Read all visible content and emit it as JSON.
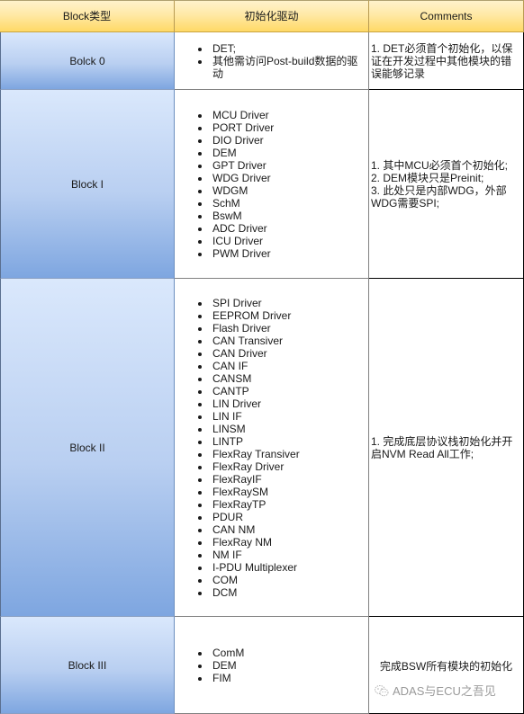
{
  "header": {
    "col1": "Block类型",
    "col2": "初始化驱动",
    "col3": "Comments"
  },
  "rows": [
    {
      "block": "Bolck 0",
      "drivers": [
        "DET;",
        "其他需访问Post-build数据的驱动"
      ],
      "comments": [
        "1. DET必须首个初始化，以保证在开发过程中其他模块的错误能够记录"
      ]
    },
    {
      "block": "Block I",
      "drivers": [
        "MCU  Driver",
        "PORT Driver",
        "DIO Driver",
        "DEM",
        "GPT Driver",
        "WDG Driver",
        "WDGM",
        "SchM",
        "BswM",
        "ADC Driver",
        "ICU Driver",
        "PWM Driver"
      ],
      "comments": [
        "1. 其中MCU必须首个初始化;",
        "2. DEM模块只是Preinit;",
        "3. 此处只是内部WDG，外部WDG需要SPI;"
      ]
    },
    {
      "block": "Block II",
      "drivers": [
        "SPI Driver",
        "EEPROM Driver",
        "Flash Driver",
        "CAN Transiver",
        "CAN Driver",
        "CAN IF",
        "CANSM",
        "CANTP",
        "LIN Driver",
        "LIN  IF",
        "LINSM",
        "LINTP",
        "FlexRay Transiver",
        "FlexRay Driver",
        "FlexRayIF",
        "FlexRaySM",
        "FlexRayTP",
        "PDUR",
        "CAN NM",
        "FlexRay NM",
        "NM IF",
        "I-PDU Multiplexer",
        "COM",
        "DCM"
      ],
      "comments": [
        "1. 完成底层协议栈初始化并开启NVM Read All工作;"
      ]
    },
    {
      "block": "Block III",
      "drivers": [
        "ComM",
        "DEM",
        "FIM"
      ],
      "comments": [
        "完成BSW所有模块的初始化"
      ]
    }
  ],
  "watermark": {
    "icon": "wechat-icon",
    "text": "ADAS与ECU之吾见"
  }
}
